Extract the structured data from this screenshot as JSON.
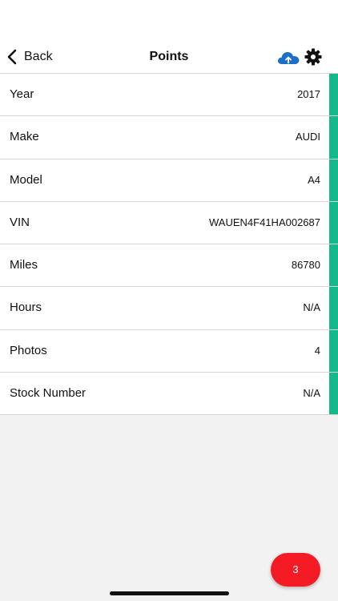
{
  "nav": {
    "back_label": "Back",
    "title": "Points"
  },
  "icons": {
    "back": "chevron-left-icon",
    "upload": "cloud-upload-icon",
    "settings": "gear-icon"
  },
  "colors": {
    "accent_green": "#14b88a",
    "cloud_blue": "#1e6fc8",
    "fab_red": "#f51b24"
  },
  "rows": [
    {
      "label": "Year",
      "value": "2017"
    },
    {
      "label": "Make",
      "value": "AUDI"
    },
    {
      "label": "Model",
      "value": "A4"
    },
    {
      "label": "VIN",
      "value": "WAUEN4F41HA002687"
    },
    {
      "label": "Miles",
      "value": "86780"
    },
    {
      "label": "Hours",
      "value": "N/A"
    },
    {
      "label": "Photos",
      "value": "4"
    },
    {
      "label": "Stock Number",
      "value": "N/A"
    }
  ],
  "fab": {
    "count": "3"
  }
}
